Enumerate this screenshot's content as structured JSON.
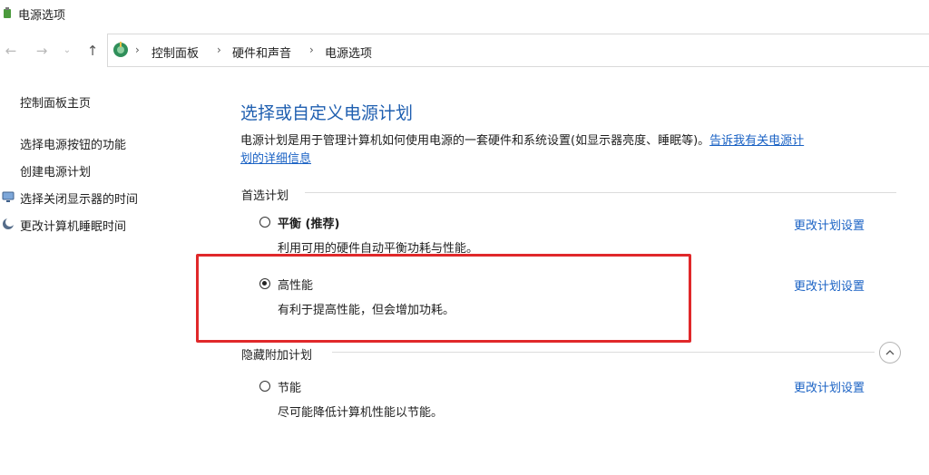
{
  "window": {
    "title": "电源选项"
  },
  "breadcrumb": [
    "控制面板",
    "硬件和声音",
    "电源选项"
  ],
  "sidebar": {
    "home": "控制面板主页",
    "links": [
      "选择电源按钮的功能",
      "创建电源计划",
      "选择关闭显示器的时间",
      "更改计算机睡眠时间"
    ]
  },
  "main": {
    "title": "选择或自定义电源计划",
    "description": "电源计划是用于管理计算机如何使用电源的一套硬件和系统设置(如显示器亮度、睡眠等)。",
    "description_link_line1": "告诉我有关电源计",
    "description_link_line2": "划的详细信息",
    "preferred_label": "首选计划",
    "hidden_label": "隐藏附加计划",
    "plans": [
      {
        "name": "平衡 (推荐)",
        "desc": "利用可用的硬件自动平衡功耗与性能。",
        "selected": false,
        "link": "更改计划设置"
      },
      {
        "name": "高性能",
        "desc": "有利于提高性能，但会增加功耗。",
        "selected": true,
        "link": "更改计划设置"
      },
      {
        "name": "节能",
        "desc": "尽可能降低计算机性能以节能。",
        "selected": false,
        "link": "更改计划设置"
      }
    ]
  },
  "icons": {
    "back": "arrow-left-icon",
    "forward": "arrow-right-icon",
    "recent": "chevron-down-icon",
    "up": "arrow-up-icon",
    "collapse": "chevron-up-icon"
  },
  "colors": {
    "link": "#1a62c4",
    "title": "#1f5fb0",
    "highlight": "#e0282a"
  }
}
